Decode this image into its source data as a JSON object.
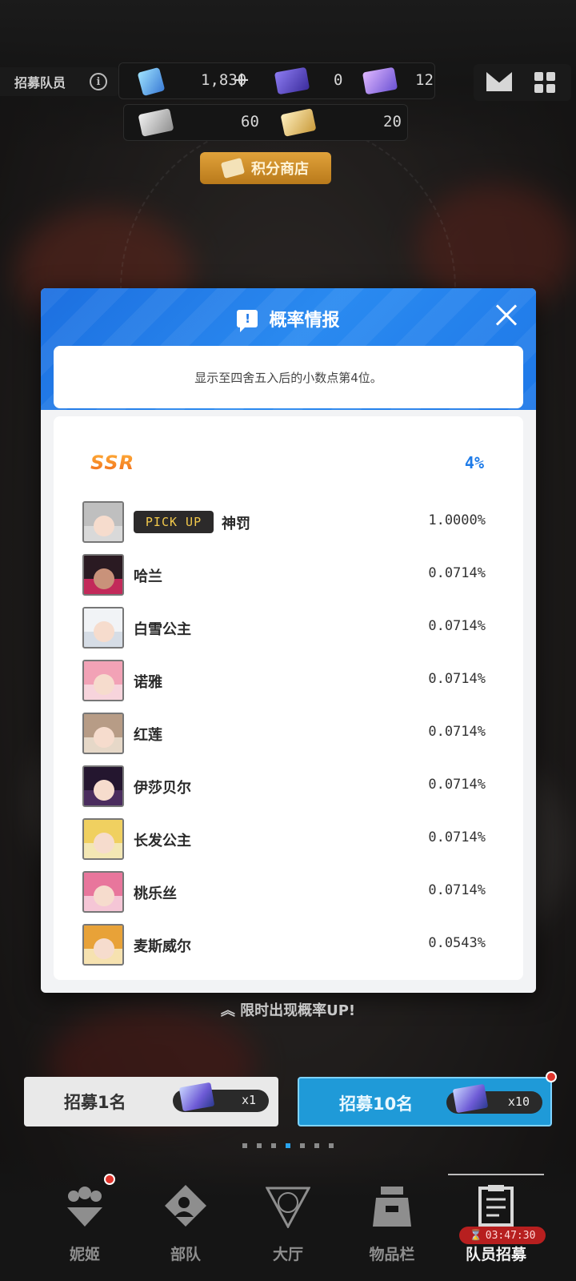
{
  "header": {
    "recruit_label": "招募队员",
    "info_icon": "info-icon",
    "currencies": [
      {
        "icon": "gem-icon",
        "value": "1,830"
      },
      {
        "icon": "ticket-purple-icon",
        "value": "0"
      },
      {
        "icon": "ticket-pink-icon",
        "value": "12"
      },
      {
        "icon": "ticket-silver-icon",
        "value": "60"
      },
      {
        "icon": "ticket-gold-icon",
        "value": "20"
      }
    ],
    "plus_label": "+",
    "mail_icon": "mail-icon",
    "menu_icon": "grid-menu-icon",
    "shop_label": "积分商店"
  },
  "modal": {
    "title": "概率情报",
    "title_icon_glyph": "!",
    "note": "显示至四舍五入后的小数点第4位。",
    "tier": "SSR",
    "tier_rate": "4%",
    "pickup_label": "PICK UP",
    "rows": [
      {
        "name": "神罚",
        "rate": "1.0000%",
        "pickup": true
      },
      {
        "name": "哈兰",
        "rate": "0.0714%"
      },
      {
        "name": "白雪公主",
        "rate": "0.0714%"
      },
      {
        "name": "诺雅",
        "rate": "0.0714%"
      },
      {
        "name": "红莲",
        "rate": "0.0714%"
      },
      {
        "name": "伊莎贝尔",
        "rate": "0.0714%"
      },
      {
        "name": "长发公主",
        "rate": "0.0714%"
      },
      {
        "name": "桃乐丝",
        "rate": "0.0714%"
      },
      {
        "name": "麦斯威尔",
        "rate": "0.0543%"
      }
    ]
  },
  "footer": {
    "up_hint": "限时出现概率UP!",
    "pull_one": {
      "label": "招募1名",
      "count": "x1"
    },
    "pull_ten": {
      "label": "招募10名",
      "count": "x10"
    },
    "timer": "03:47:30",
    "nav": [
      {
        "label": "妮姬",
        "icon": "nikke-icon"
      },
      {
        "label": "部队",
        "icon": "squad-icon"
      },
      {
        "label": "大厅",
        "icon": "lobby-icon"
      },
      {
        "label": "物品栏",
        "icon": "inventory-icon"
      },
      {
        "label": "队员招募",
        "icon": "recruit-icon"
      }
    ]
  },
  "colors": {
    "accent_blue": "#1e7be8",
    "pickup_gold": "#f2c94c",
    "ssr_orange": "#f08a2a",
    "alert_red": "#e0342c"
  }
}
